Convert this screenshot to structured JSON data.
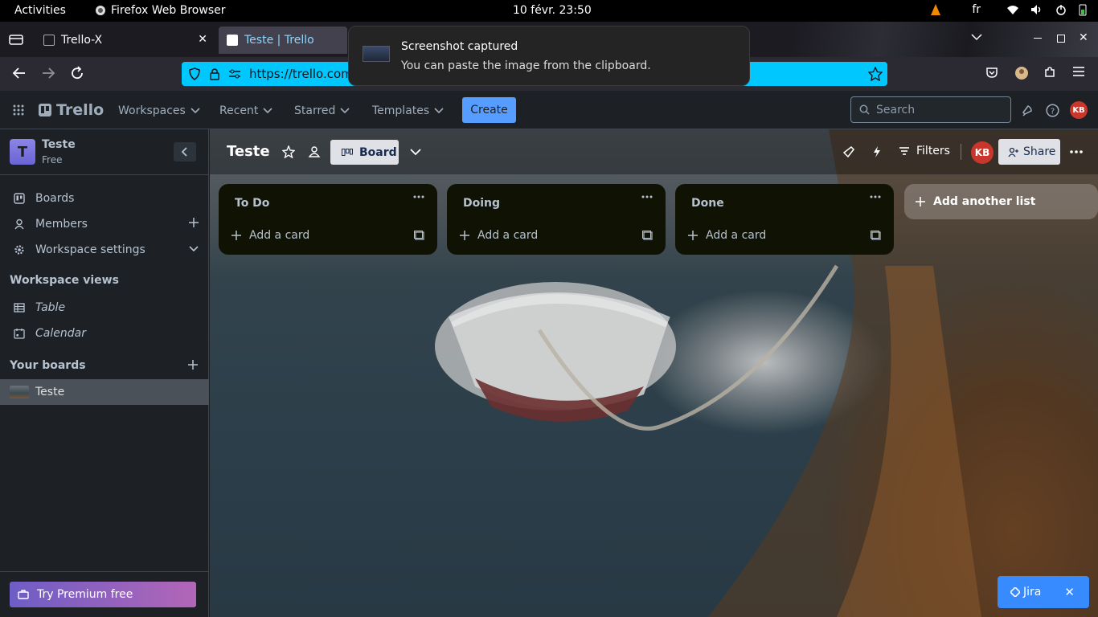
{
  "gnome": {
    "activities": "Activities",
    "app_name": "Firefox Web Browser",
    "clock": "10 févr.  23:50",
    "lang": "fr"
  },
  "browser": {
    "tabs": [
      {
        "label": "Trello-X"
      },
      {
        "label": "Teste | Trello"
      }
    ],
    "url": "https://trello.com"
  },
  "notification": {
    "title": "Screenshot captured",
    "body": "You can paste the image from the clipboard."
  },
  "trello": {
    "logo": "Trello",
    "nav": {
      "workspaces": "Workspaces",
      "recent": "Recent",
      "starred": "Starred",
      "templates": "Templates"
    },
    "create_label": "Create",
    "search_placeholder": "Search",
    "avatar_initials": "KB"
  },
  "sidebar": {
    "workspace_initial": "T",
    "workspace_name": "Teste",
    "workspace_plan": "Free",
    "items": [
      {
        "label": "Boards",
        "icon": "trello-board-icon"
      },
      {
        "label": "Members",
        "icon": "person-icon"
      },
      {
        "label": "Workspace settings",
        "icon": "gear-icon"
      }
    ],
    "views_heading": "Workspace views",
    "views": [
      {
        "label": "Table",
        "icon": "table-icon"
      },
      {
        "label": "Calendar",
        "icon": "calendar-icon"
      }
    ],
    "boards_heading": "Your boards",
    "boards": [
      {
        "label": "Teste"
      }
    ],
    "premium_label": "Try Premium free"
  },
  "board": {
    "title": "Teste",
    "view_label": "Board",
    "filters_label": "Filters",
    "share_label": "Share",
    "lists": [
      {
        "title": "To Do",
        "add_label": "Add a card"
      },
      {
        "title": "Doing",
        "add_label": "Add a card"
      },
      {
        "title": "Done",
        "add_label": "Add a card"
      }
    ],
    "add_list_label": "Add another list"
  },
  "jira": {
    "label": "Jira"
  }
}
